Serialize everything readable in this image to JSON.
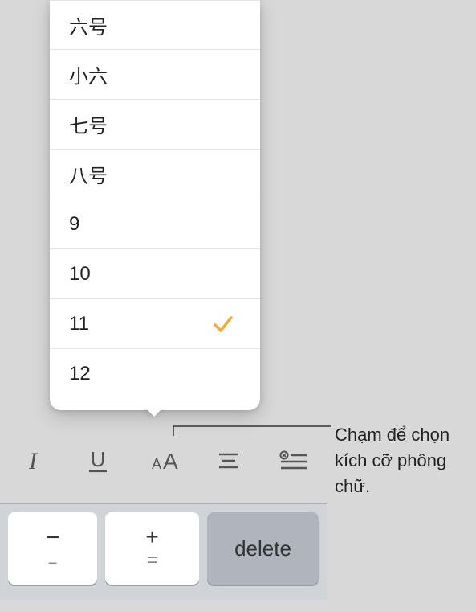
{
  "fontSizes": {
    "items": [
      {
        "label": "六号",
        "selected": false
      },
      {
        "label": "小六",
        "selected": false
      },
      {
        "label": "七号",
        "selected": false
      },
      {
        "label": "八号",
        "selected": false
      },
      {
        "label": "9",
        "selected": false
      },
      {
        "label": "10",
        "selected": false
      },
      {
        "label": "11",
        "selected": true
      },
      {
        "label": "12",
        "selected": false
      }
    ]
  },
  "toolbar": {
    "italic": "I",
    "underline": "U",
    "fontsize": "AA",
    "align": "align",
    "indent": "indent"
  },
  "keyboard": {
    "minus": "−",
    "plus": "+",
    "equals": "=",
    "minus2": "−",
    "delete": "delete"
  },
  "callout": {
    "text": "Chạm để chọn kích cỡ phông chữ."
  },
  "colors": {
    "accent": "#f7a93b"
  }
}
